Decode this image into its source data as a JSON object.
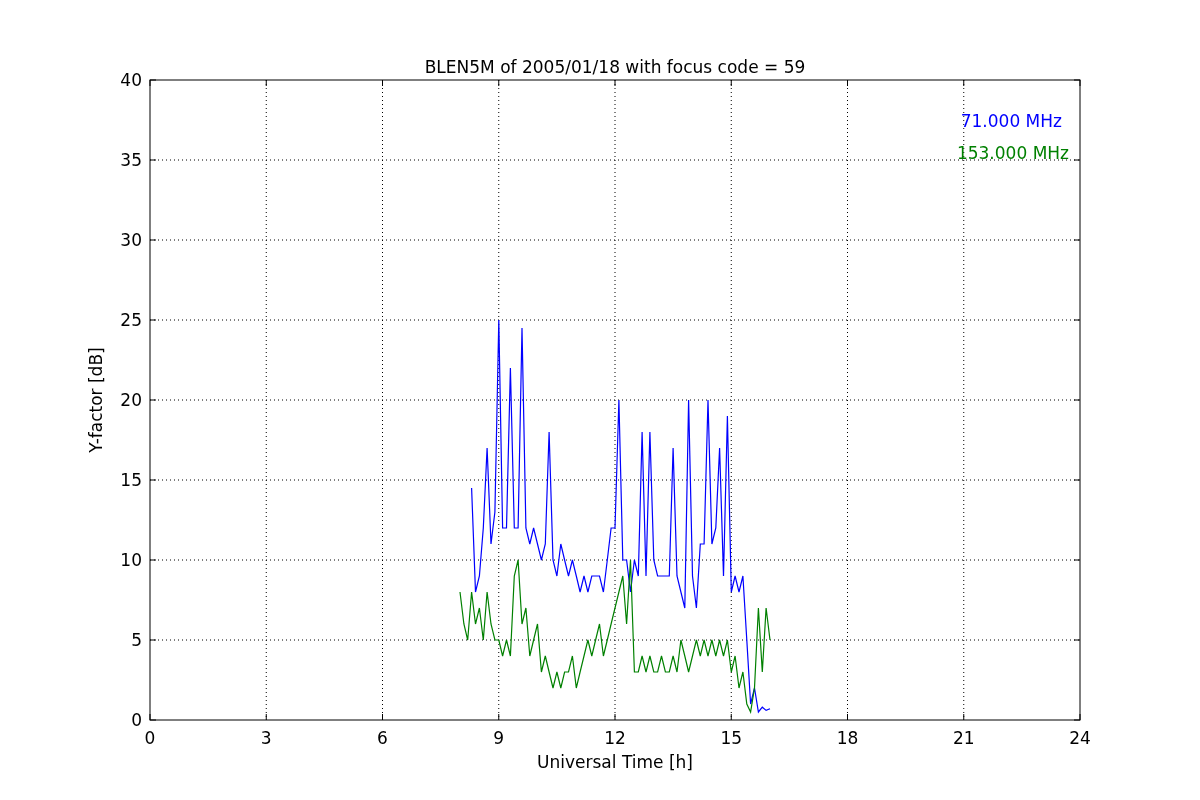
{
  "chart_data": {
    "type": "line",
    "title": "BLEN5M of 2005/01/18 with focus code = 59",
    "xlabel": "Universal Time [h]",
    "ylabel": "Y-factor [dB]",
    "x": [
      8.0,
      8.1,
      8.2,
      8.3,
      8.4,
      8.5,
      8.6,
      8.7,
      8.8,
      8.9,
      9.0,
      9.1,
      9.2,
      9.3,
      9.4,
      9.5,
      9.6,
      9.7,
      9.8,
      9.9,
      10.0,
      10.1,
      10.2,
      10.3,
      10.4,
      10.5,
      10.6,
      10.7,
      10.8,
      10.9,
      11.0,
      11.1,
      11.2,
      11.3,
      11.4,
      11.5,
      11.6,
      11.7,
      11.8,
      11.9,
      12.0,
      12.1,
      12.2,
      12.3,
      12.4,
      12.5,
      12.6,
      12.7,
      12.8,
      12.9,
      13.0,
      13.1,
      13.2,
      13.3,
      13.4,
      13.5,
      13.6,
      13.7,
      13.8,
      13.9,
      14.0,
      14.1,
      14.2,
      14.3,
      14.4,
      14.5,
      14.6,
      14.7,
      14.8,
      14.9,
      15.0,
      15.1,
      15.2,
      15.3,
      15.4,
      15.5,
      15.6,
      15.7,
      15.8,
      15.9,
      16.0
    ],
    "series": [
      {
        "name": "71.000 MHz",
        "color": "#0000ff",
        "values": [
          null,
          null,
          null,
          14.5,
          8,
          9,
          12,
          17,
          11,
          13,
          25,
          12,
          12,
          22,
          12,
          12,
          24.5,
          12,
          11,
          12,
          11,
          10,
          11,
          18,
          10,
          9,
          11,
          10,
          9,
          10,
          9,
          8,
          9,
          8,
          9,
          9,
          9,
          8,
          10,
          12,
          12,
          20,
          10,
          10,
          8,
          10,
          9,
          18,
          9,
          18,
          10,
          9,
          9,
          9,
          9,
          17,
          9,
          8,
          7,
          20,
          9,
          7,
          11,
          11,
          20,
          11,
          12,
          17,
          9,
          19,
          8,
          9,
          8,
          9,
          5,
          1,
          2,
          0.5,
          0.8,
          0.6,
          0.7
        ]
      },
      {
        "name": "153.000 MHz",
        "color": "#008000",
        "values": [
          8,
          6,
          5,
          8,
          6,
          7,
          5,
          8,
          6,
          5,
          5,
          4,
          5,
          4,
          9,
          10,
          6,
          7,
          4,
          5,
          6,
          3,
          4,
          3,
          2,
          3,
          2,
          3,
          3,
          4,
          2,
          3,
          4,
          5,
          4,
          5,
          6,
          4,
          5,
          6,
          7,
          8,
          9,
          6,
          10,
          3,
          3,
          4,
          3,
          4,
          3,
          3,
          4,
          3,
          3,
          4,
          3,
          5,
          4,
          3,
          4,
          5,
          4,
          5,
          4,
          5,
          4,
          5,
          4,
          5,
          3,
          4,
          2,
          3,
          1,
          0.5,
          2,
          7,
          3,
          7,
          5
        ]
      }
    ],
    "grid": true,
    "xlim": [
      0,
      24
    ],
    "ylim": [
      0,
      40
    ],
    "xticks": [
      0,
      3,
      6,
      9,
      12,
      15,
      18,
      21,
      24
    ],
    "yticks": [
      0,
      5,
      10,
      15,
      20,
      25,
      30,
      35,
      40
    ]
  }
}
